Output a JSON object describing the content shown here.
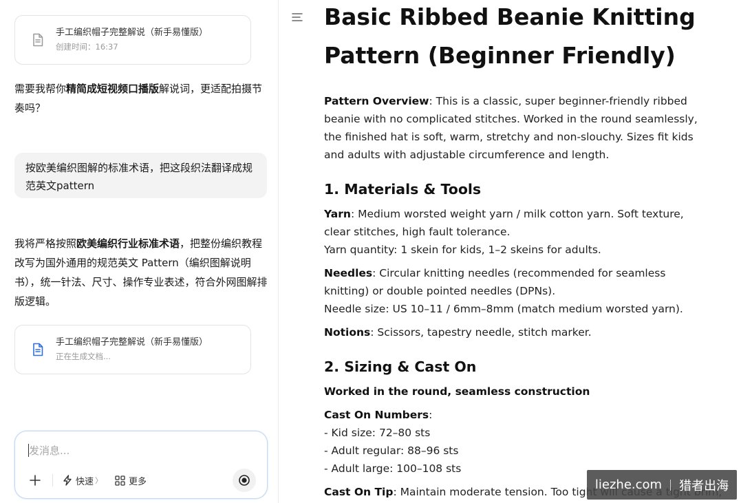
{
  "chat": {
    "card_top": {
      "title": "手工编织帽子完整解说（新手易懂版）",
      "subtitle": "创建时间：16:37"
    },
    "ai_msg1": {
      "pre": "需要我帮你",
      "bold": "精简成短视频口播版",
      "post": "解说词，更适配拍摄节奏吗？"
    },
    "user_msg": "按欧美编织图解的标准术语，把这段织法翻译成规范英文pattern",
    "ai_msg2": {
      "pre": "我将严格按照",
      "bold": "欧美编织行业标准术语",
      "post": "，把整份编织教程改写为国外通用的规范英文 Pattern（编织图解说明书），统一针法、尺寸、操作专业表述，符合外网图解排版逻辑。"
    },
    "card_bottom": {
      "title": "手工编织帽子完整解说（新手易懂版）",
      "subtitle": "正在生成文档..."
    },
    "composer": {
      "placeholder": "发消息...",
      "quick_label": "快速",
      "more_label": "更多"
    }
  },
  "doc": {
    "title": "Basic Ribbed Beanie Knitting Pattern (Beginner Friendly)",
    "overview_label": "Pattern Overview",
    "overview_text": ": This is a classic, super beginner-friendly ribbed beanie with no complicated stitches. Worked in the round seamlessly, the finished hat is soft, warm, stretchy and non-slouchy. Sizes fit kids and adults with adjustable circumference and length.",
    "section1_title": "1. Materials & Tools",
    "yarn_label": "Yarn",
    "yarn_text": ": Medium worsted weight yarn / milk cotton yarn. Soft texture, clear stitches, high fault tolerance.",
    "yarn_qty": "Yarn quantity: 1 skein for kids, 1–2 skeins for adults.",
    "needles_label": "Needles",
    "needles_text": ": Circular knitting needles (recommended for seamless knitting) or double pointed needles (DPNs).",
    "needle_size": "Needle size: US 10–11 / 6mm–8mm (match medium worsted yarn).",
    "notions_label": "Notions",
    "notions_text": ": Scissors, tapestry needle, stitch marker.",
    "section2_title": "2. Sizing & Cast On",
    "worked_line": "Worked in the round, seamless construction",
    "cast_on_label": "Cast On Numbers",
    "cast_on_colon": ":",
    "kid_size": "- Kid size: 72–80 sts",
    "adult_regular": "- Adult regular: 88–96 sts",
    "adult_large": "- Adult large: 100–108 sts",
    "tip_label": "Cast On Tip",
    "tip_text": ": Maintain moderate tension. Too tight will cause a tight brim,"
  },
  "watermark": {
    "left": "liezhe.com",
    "right": "猎者出海"
  },
  "colors": {
    "accent_blue": "#2f6fe0",
    "composer_border": "#c7d9f5"
  }
}
